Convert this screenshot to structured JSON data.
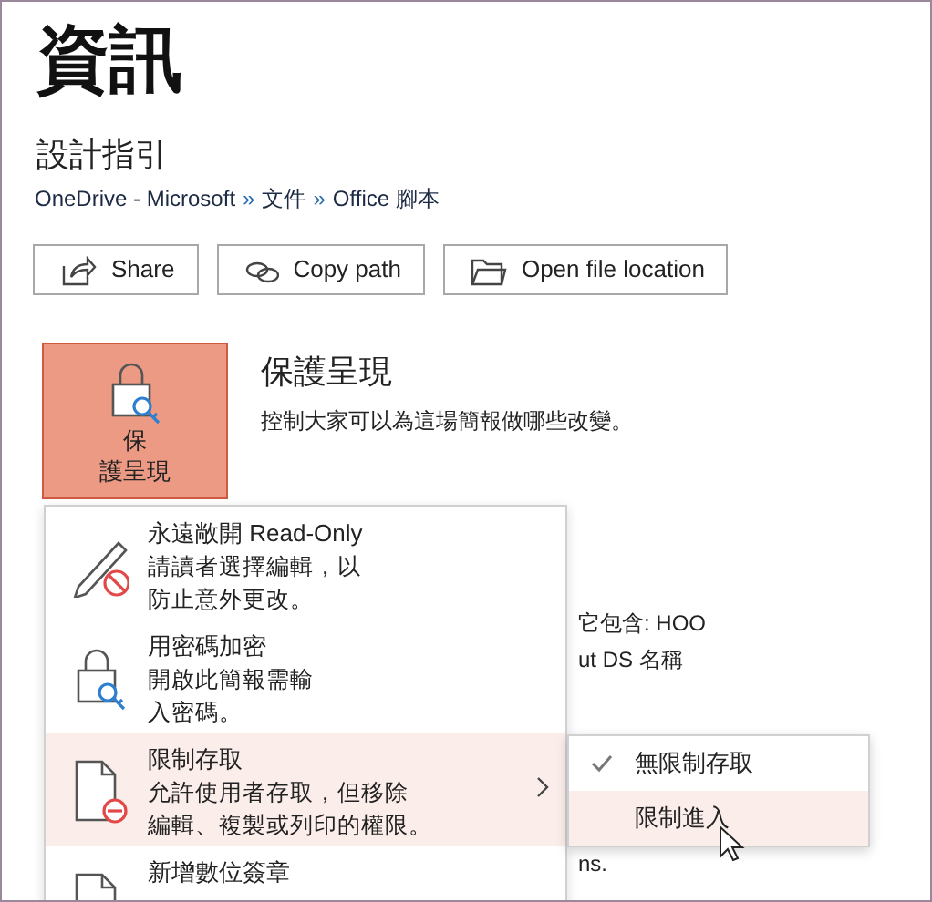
{
  "page_title": "資訊",
  "document_title": "設計指引",
  "breadcrumb": [
    {
      "text": "OneDrive - Microsoft",
      "kind": "link"
    },
    {
      "text": "»",
      "kind": "separator"
    },
    {
      "text": "文件",
      "kind": "link"
    },
    {
      "text": "»",
      "kind": "separator"
    },
    {
      "text": "Office 腳本",
      "kind": "link"
    }
  ],
  "actions": [
    {
      "label": "Share"
    },
    {
      "label": "Copy path"
    },
    {
      "label": "Open file location"
    }
  ],
  "protect": {
    "button_lines": [
      "保",
      "護呈現"
    ],
    "heading": "保護呈現",
    "description": "控制大家可以為這場簡報做哪些改變。",
    "expanded": true
  },
  "background_fragments": [
    "它包含: HOO",
    "ut DS 名稱",
    "ns."
  ],
  "menu": [
    {
      "title": "永遠敞開 Read-Only",
      "description_lines": [
        "請讀者選擇編輯，以",
        "防止意外更改。"
      ],
      "selected": false,
      "has_submenu": false
    },
    {
      "title": "用密碼加密",
      "description_lines": [
        "開啟此簡報需輸",
        "入密碼。"
      ],
      "selected": false,
      "has_submenu": false
    },
    {
      "title": "限制存取",
      "description_lines": [
        "允許使用者存取，但移除",
        "編輯、複製或列印的權限。"
      ],
      "selected": true,
      "has_submenu": true
    },
    {
      "title": "新增數位簽章",
      "selected": false,
      "has_submenu": false
    }
  ],
  "submenu": [
    {
      "label": "無限制存取",
      "checked": true,
      "selected": false
    },
    {
      "label": "限制進入",
      "checked": false,
      "selected": true
    }
  ]
}
